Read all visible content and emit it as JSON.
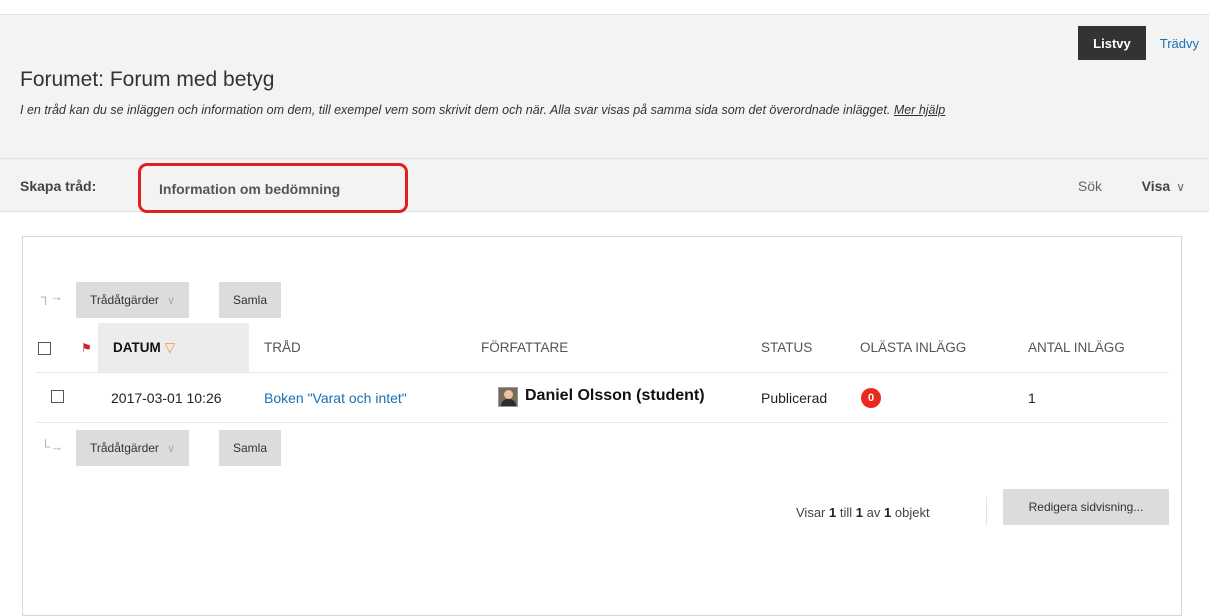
{
  "view_toggle": {
    "list_view": "Listvy",
    "tree_view": "Trädvy"
  },
  "page": {
    "title": "Forumet: Forum med betyg",
    "description": "I en tråd kan du se inläggen och information om dem, till exempel vem som skrivit dem och när. Alla svar visas på samma sida som det överordnade inlägget.",
    "help_link": "Mer hjälp"
  },
  "action_bar": {
    "create_label": "Skapa tråd:",
    "grading_info": "Information om bedömning",
    "search": "Sök",
    "view": "Visa"
  },
  "toolbar": {
    "thread_actions": "Trådåtgärder",
    "collect": "Samla"
  },
  "table": {
    "headers": {
      "date": "DATUM",
      "thread": "TRÅD",
      "author": "FÖRFATTARE",
      "status": "STATUS",
      "unread": "OLÄSTA INLÄGG",
      "total": "ANTAL INLÄGG"
    },
    "rows": [
      {
        "date": "2017-03-01 10:26",
        "thread": "Boken \"Varat och intet\"",
        "author": "Daniel Olsson (student)",
        "status": "Publicerad",
        "unread": "0",
        "total": "1"
      }
    ]
  },
  "paging": {
    "prefix": "Visar",
    "from": "1",
    "to_word": "till",
    "to": "1",
    "of_word": "av",
    "total": "1",
    "suffix": "objekt",
    "edit_button": "Redigera sidvisning..."
  },
  "colors": {
    "accent_red": "#e02020",
    "badge_red": "#e8291c",
    "link_blue": "#1a6fb0",
    "dark_button": "#333333"
  }
}
